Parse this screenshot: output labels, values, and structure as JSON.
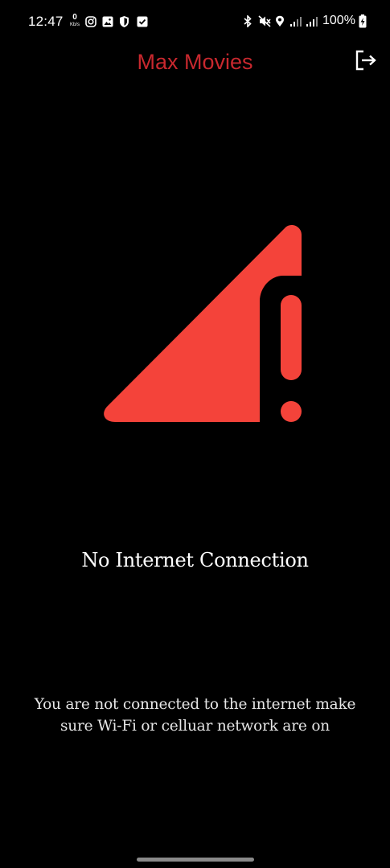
{
  "status_bar": {
    "time": "12:47",
    "net_speed_value": "0",
    "net_speed_unit": "Kb/s",
    "battery_percent": "100%",
    "icons_left": [
      "instagram-icon",
      "gallery-icon",
      "shield-icon",
      "checkbox-icon"
    ],
    "icons_right": [
      "bluetooth-icon",
      "vibrate-mute-icon",
      "location-icon",
      "signal-icon",
      "signal-icon",
      "battery-charging-icon"
    ]
  },
  "app_bar": {
    "title": "Max Movies",
    "title_color": "#c8282e",
    "logout_icon": "logout-icon"
  },
  "main": {
    "graphic_icon": "no-signal-warning-icon",
    "accent_color": "#f4433a",
    "heading": "No Internet Connection",
    "message": "You are not connected to the internet make sure Wi-Fi or celluar network are on"
  }
}
